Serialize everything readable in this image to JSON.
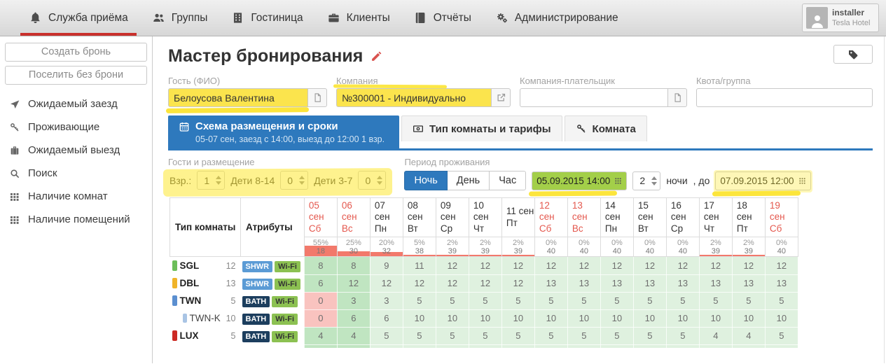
{
  "navbar": {
    "items": [
      {
        "label": "Служба приёма",
        "icon": "bell",
        "active": true
      },
      {
        "label": "Группы",
        "icon": "users",
        "active": false
      },
      {
        "label": "Гостиница",
        "icon": "building",
        "active": false
      },
      {
        "label": "Клиенты",
        "icon": "briefcase",
        "active": false
      },
      {
        "label": "Отчёты",
        "icon": "book",
        "active": false
      },
      {
        "label": "Администрирование",
        "icon": "gears",
        "active": false
      }
    ],
    "user": {
      "name": "installer",
      "hotel": "Tesla Hotel"
    },
    "active_underline_color": "#c9302c"
  },
  "sidebar": {
    "buttons": [
      "Создать бронь",
      "Поселить без брони"
    ],
    "items": [
      {
        "icon": "plane",
        "label": "Ожидаемый заезд"
      },
      {
        "icon": "key",
        "label": "Проживающие"
      },
      {
        "icon": "suitcase",
        "label": "Ожидаемый выезд"
      },
      {
        "icon": "search",
        "label": "Поиск"
      },
      {
        "icon": "grid",
        "label": "Наличие комнат"
      },
      {
        "icon": "grid",
        "label": "Наличие помещений"
      }
    ]
  },
  "main": {
    "title": "Мастер бронирования",
    "fields": {
      "guest": {
        "label": "Гость (ФИО)",
        "value": "Белоусова Валентина",
        "highlight": "yellow"
      },
      "company": {
        "label": "Компания",
        "value": "№300001 - Индивидуально",
        "highlight": "yellow"
      },
      "payer": {
        "label": "Компания-плательщик",
        "value": ""
      },
      "quota": {
        "label": "Квота/группа",
        "value": ""
      }
    },
    "tabs": [
      {
        "label": "Схема размещения и сроки",
        "sub": "05-07 сен, заезд с 14:00, выезд до 12:00 1 взр.",
        "icon": "calendar",
        "active": true
      },
      {
        "label": "Тип комнаты и тарифы",
        "icon": "money",
        "active": false
      },
      {
        "label": "Комната",
        "icon": "key",
        "active": false
      }
    ],
    "guests": {
      "section_label": "Гости и размещение",
      "adults_label": "Взр.:",
      "adults": "1",
      "children_8_14_label": "Дети 8-14",
      "children_8_14": "0",
      "children_3_7_label": "Дети 3-7",
      "children_3_7": "0"
    },
    "period": {
      "section_label": "Период проживания",
      "modes": [
        "Ночь",
        "День",
        "Час"
      ],
      "active_mode": "Ночь",
      "checkin": "05.09.2015 14:00",
      "nights": "2",
      "nights_label": "ночи",
      "to_label": ", до",
      "checkout": "07.09.2015 12:00"
    },
    "table": {
      "type_header": "Тип комнаты",
      "attrs_header": "Атрибуты",
      "badge_colors": {
        "SHWR": {
          "bg": "#5b9bd5",
          "fg": "#ffffff"
        },
        "BATH": {
          "bg": "#1c3e5e",
          "fg": "#ffffff"
        },
        "Wi-Fi": {
          "bg": "#8cc152",
          "fg": "#333333"
        }
      },
      "colors": {
        "cell_free": "#dff1df",
        "cell_period": "#c0e5c1",
        "cell_zero": "#f9c3bf",
        "occupancy_bar": "#f2796b",
        "weekend_text": "#e4584e",
        "accent_blue": "#2e79bd"
      },
      "columns": [
        {
          "date": "05 сен",
          "dow": "Сб",
          "weekend": true,
          "period": true,
          "pct": "55%",
          "pct_value": 55,
          "free": "18"
        },
        {
          "date": "06 сен",
          "dow": "Вс",
          "weekend": true,
          "period": true,
          "pct": "25%",
          "pct_value": 25,
          "free": "30"
        },
        {
          "date": "07 сен",
          "dow": "Пн",
          "weekend": false,
          "period": false,
          "pct": "20%",
          "pct_value": 20,
          "free": "32"
        },
        {
          "date": "08 сен",
          "dow": "Вт",
          "weekend": false,
          "period": false,
          "pct": "5%",
          "pct_value": 5,
          "free": "38"
        },
        {
          "date": "09 сен",
          "dow": "Ср",
          "weekend": false,
          "period": false,
          "pct": "2%",
          "pct_value": 2,
          "free": "39"
        },
        {
          "date": "10 сен",
          "dow": "Чт",
          "weekend": false,
          "period": false,
          "pct": "2%",
          "pct_value": 2,
          "free": "39"
        },
        {
          "date": "11 сен",
          "dow": "Пт",
          "weekend": false,
          "period": false,
          "pct": "2%",
          "pct_value": 2,
          "free": "39"
        },
        {
          "date": "12 сен",
          "dow": "Сб",
          "weekend": true,
          "period": false,
          "pct": "0%",
          "pct_value": 0,
          "free": "40"
        },
        {
          "date": "13 сен",
          "dow": "Вс",
          "weekend": true,
          "period": false,
          "pct": "0%",
          "pct_value": 0,
          "free": "40"
        },
        {
          "date": "14 сен",
          "dow": "Пн",
          "weekend": false,
          "period": false,
          "pct": "0%",
          "pct_value": 0,
          "free": "40"
        },
        {
          "date": "15 сен",
          "dow": "Вт",
          "weekend": false,
          "period": false,
          "pct": "0%",
          "pct_value": 0,
          "free": "40"
        },
        {
          "date": "16 сен",
          "dow": "Ср",
          "weekend": false,
          "period": false,
          "pct": "0%",
          "pct_value": 0,
          "free": "40"
        },
        {
          "date": "17 сен",
          "dow": "Чт",
          "weekend": false,
          "period": false,
          "pct": "2%",
          "pct_value": 2,
          "free": "39"
        },
        {
          "date": "18 сен",
          "dow": "Пт",
          "weekend": false,
          "period": false,
          "pct": "2%",
          "pct_value": 2,
          "free": "39"
        },
        {
          "date": "19 сен",
          "dow": "Сб",
          "weekend": true,
          "period": false,
          "pct": "0%",
          "pct_value": 0,
          "free": "40"
        }
      ],
      "rows": [
        {
          "name": "SGL",
          "chip": "#6cbe5a",
          "count": "12",
          "indent": false,
          "badges": [
            "SHWR",
            "Wi-Fi"
          ],
          "values": [
            8,
            8,
            9,
            11,
            12,
            12,
            12,
            12,
            12,
            12,
            12,
            12,
            12,
            12,
            12
          ]
        },
        {
          "name": "DBL",
          "chip": "#f0b429",
          "count": "13",
          "indent": false,
          "badges": [
            "SHWR",
            "Wi-Fi"
          ],
          "values": [
            6,
            12,
            12,
            12,
            12,
            12,
            12,
            13,
            13,
            13,
            13,
            13,
            13,
            13,
            13
          ]
        },
        {
          "name": "TWN",
          "chip": "#5b8fd0",
          "count": "5",
          "indent": false,
          "badges": [
            "BATH",
            "Wi-Fi"
          ],
          "values": [
            0,
            3,
            3,
            5,
            5,
            5,
            5,
            5,
            5,
            5,
            5,
            5,
            5,
            5,
            5
          ]
        },
        {
          "name": "TWN-K",
          "chip": "#a9c4e4",
          "count": "10",
          "indent": true,
          "badges": [
            "BATH",
            "Wi-Fi"
          ],
          "values": [
            0,
            6,
            6,
            10,
            10,
            10,
            10,
            10,
            10,
            10,
            10,
            10,
            10,
            10,
            10
          ]
        },
        {
          "name": "LUX",
          "chip": "#cc2a24",
          "count": "5",
          "indent": false,
          "badges": [
            "BATH",
            "Wi-Fi"
          ],
          "values": [
            4,
            4,
            5,
            5,
            5,
            5,
            5,
            5,
            5,
            5,
            5,
            5,
            4,
            4,
            5
          ]
        }
      ]
    }
  }
}
